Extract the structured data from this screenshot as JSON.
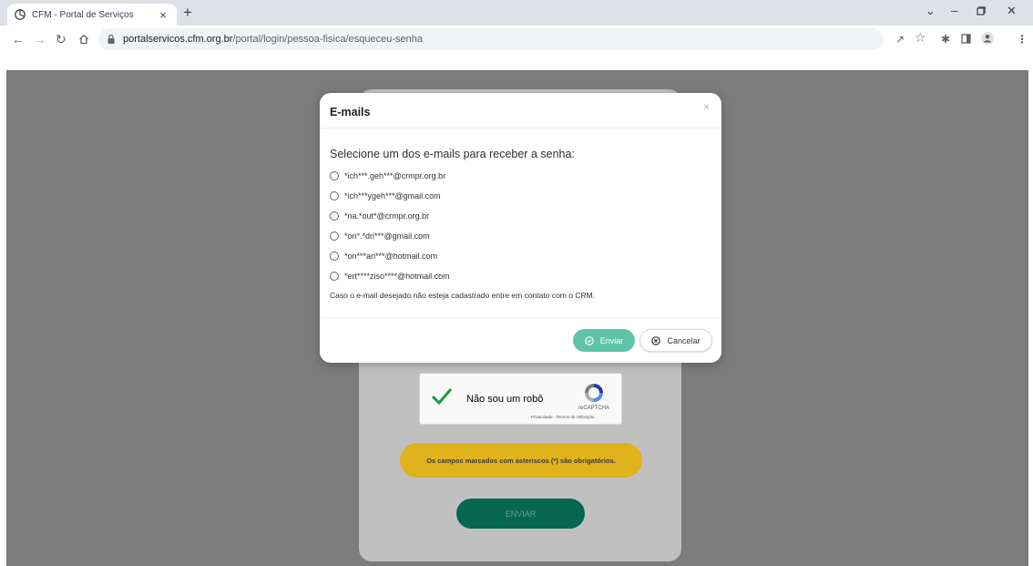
{
  "browser": {
    "tab_title": "CFM - Portal de Serviços",
    "tab_close": "×",
    "new_tab": "+",
    "url_host": "portalservicos.cfm.org.br",
    "url_path": "/portal/login/pessoa-fisica/esqueceu-senha"
  },
  "modal": {
    "title": "E-mails",
    "close": "×",
    "subtitle": "Selecione um dos e-mails para receber a senha:",
    "options": [
      "*ich***.geh***@crmpr.org.br",
      "*ich***ygeh***@gmail.com",
      "*na.*out*@crmpr.org.br",
      "*on*.*dri***@gmail.com",
      "*on***ari***@hotmail.com",
      "*ert****ziso****@hotmail.com"
    ],
    "note": "Caso o e-mail desejado não esteja cadastrado entre em contato com o CRM.",
    "submit_label": "Enviar",
    "cancel_label": "Cancelar"
  },
  "form": {
    "captcha_label": "Não sou um robô",
    "captcha_brand": "reCAPTCHA",
    "captcha_links": "Privacidade - Termos de Utilização",
    "required_note": "Os campos marcados com asteriscos (*) são obrigatórios.",
    "send_label": "ENVIAR"
  },
  "colors": {
    "modal_submit": "#5fc4a7",
    "form_send": "#07664f",
    "required_note_bg": "#e0b21b",
    "backdrop": "#7c7c7c"
  }
}
